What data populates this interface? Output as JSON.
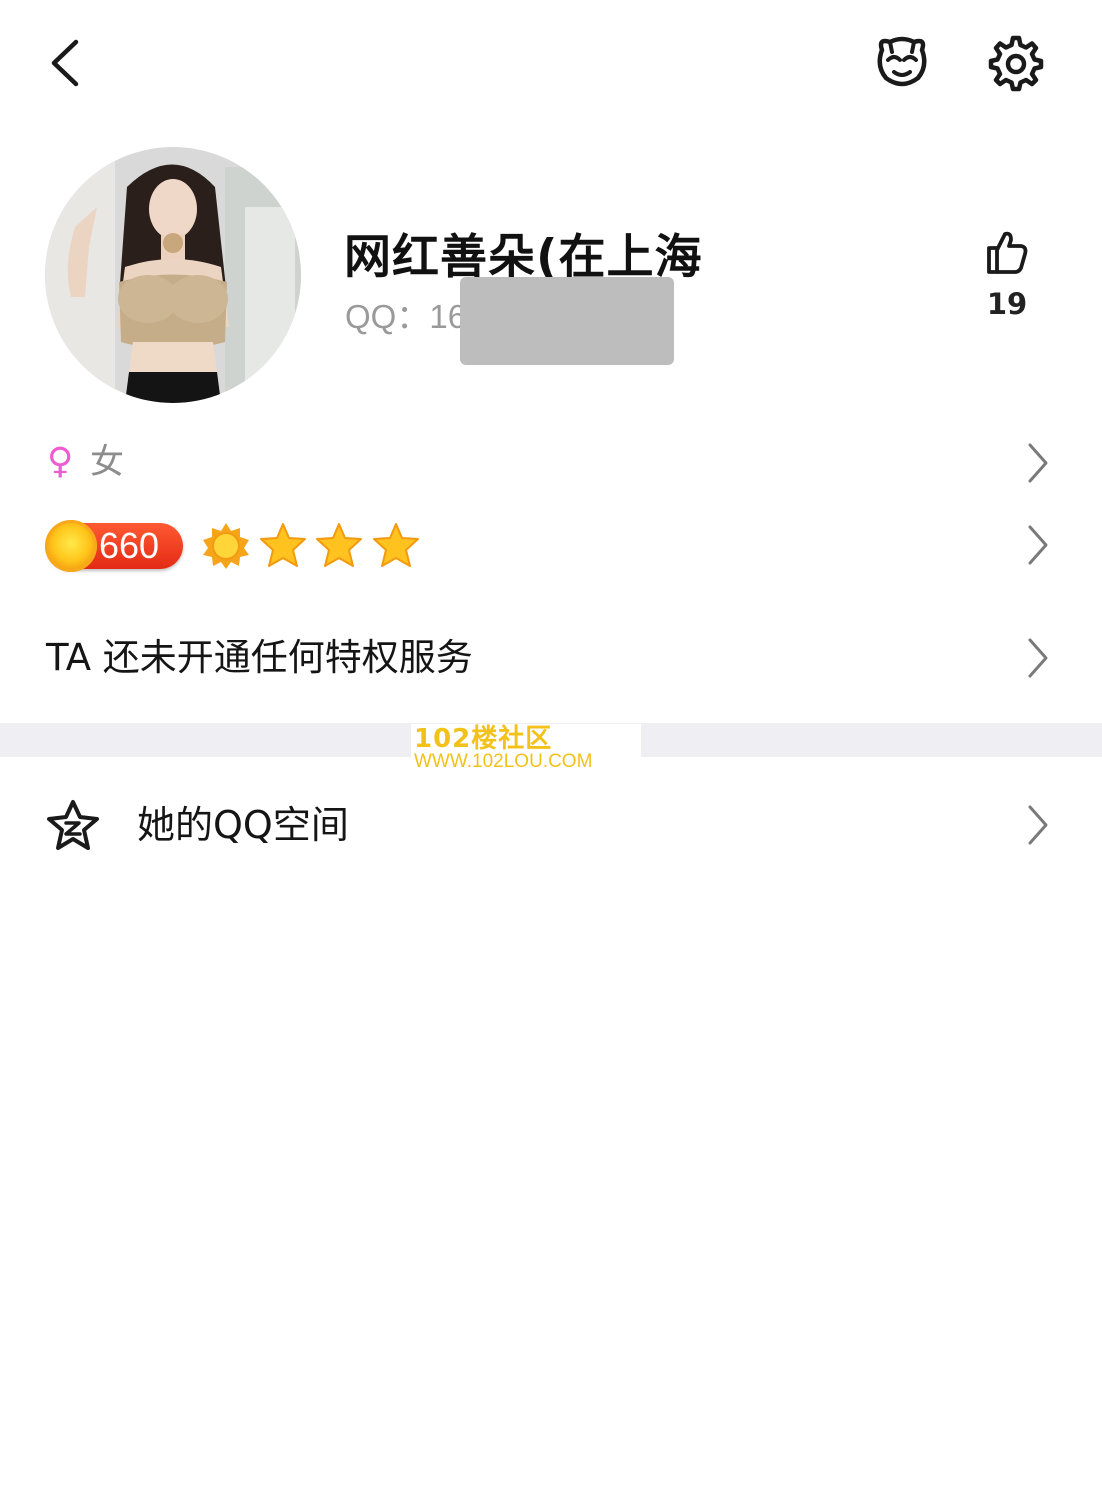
{
  "header": {
    "back_icon": "chevron-left-icon",
    "pet_icon": "bear-face-icon",
    "settings_icon": "gear-icon"
  },
  "profile": {
    "nickname": "网红善朵(在上海",
    "qq_label": "QQ：16",
    "like_count": "19",
    "like_icon": "thumb-up-icon"
  },
  "gender": {
    "symbol": "♀",
    "label": "女",
    "symbol_color": "#ef5bd0"
  },
  "level": {
    "value": "660",
    "icons": [
      "sun-icon",
      "star-icon",
      "star-icon",
      "star-icon"
    ]
  },
  "privilege": {
    "text": "TA 还未开通任何特权服务"
  },
  "watermark": {
    "title": "102楼社区",
    "url": "WWW.102LOU.COM"
  },
  "qzone": {
    "icon": "qzone-star-icon",
    "label": "她的QQ空间"
  },
  "colors": {
    "accent_red": "#e32a15",
    "gold": "#ffc61c",
    "divider": "#efeff3"
  }
}
